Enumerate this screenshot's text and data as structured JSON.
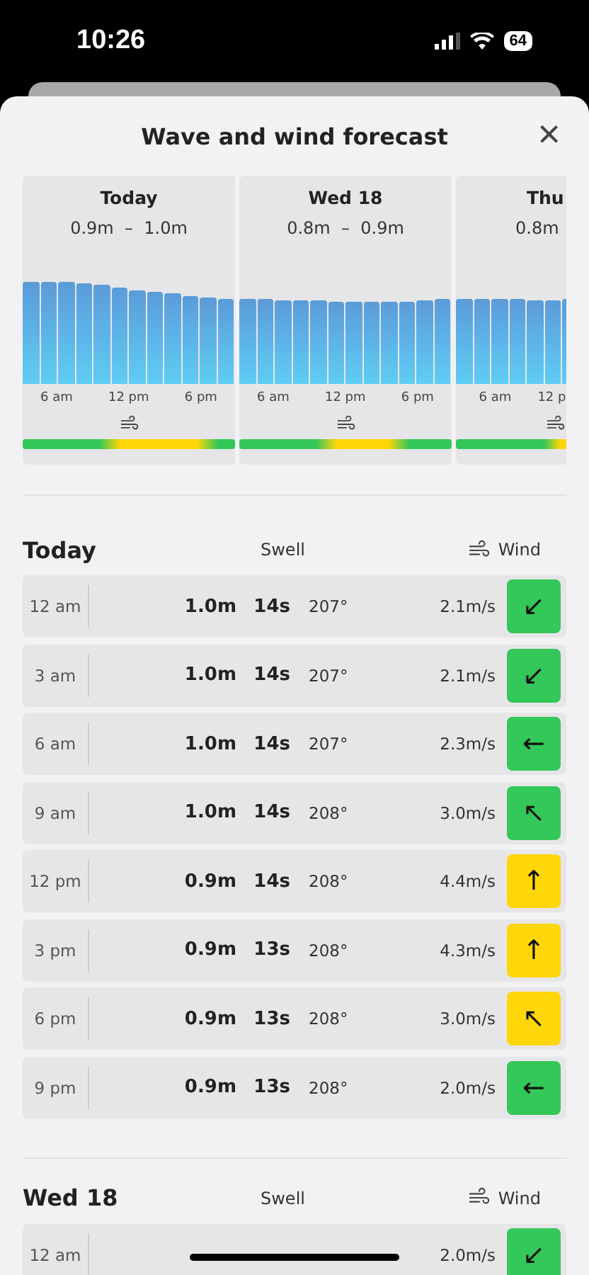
{
  "status_bar": {
    "time": "10:26",
    "battery": "64"
  },
  "sheet": {
    "title": "Wave and wind forecast",
    "close": "×"
  },
  "day_cards": [
    {
      "day": "Today",
      "range": "0.9m  –  1.0m",
      "times": [
        "6 am",
        "12 pm",
        "6 pm"
      ]
    },
    {
      "day": "Wed 18",
      "range": "0.8m  –  0.9m",
      "times": [
        "6 am",
        "12 pm",
        "6 pm"
      ]
    },
    {
      "day": "Thu",
      "range": "0.8m",
      "times": [
        "6 am",
        "12 p"
      ]
    }
  ],
  "days": [
    {
      "title": "Today",
      "swell_label": "Swell",
      "wind_label": "Wind",
      "rows": [
        {
          "time": "12 am",
          "height": "1.0m",
          "period": "14s",
          "direction": "207°",
          "speed": "2.1m/s",
          "arrow": "↙",
          "color": "#34c759"
        },
        {
          "time": "3 am",
          "height": "1.0m",
          "period": "14s",
          "direction": "207°",
          "speed": "2.1m/s",
          "arrow": "↙",
          "color": "#34c759"
        },
        {
          "time": "6 am",
          "height": "1.0m",
          "period": "14s",
          "direction": "207°",
          "speed": "2.3m/s",
          "arrow": "←",
          "color": "#34c759"
        },
        {
          "time": "9 am",
          "height": "1.0m",
          "period": "14s",
          "direction": "208°",
          "speed": "3.0m/s",
          "arrow": "↖",
          "color": "#34c759"
        },
        {
          "time": "12 pm",
          "height": "0.9m",
          "period": "14s",
          "direction": "208°",
          "speed": "4.4m/s",
          "arrow": "↑",
          "color": "#ffd60a"
        },
        {
          "time": "3 pm",
          "height": "0.9m",
          "period": "13s",
          "direction": "208°",
          "speed": "4.3m/s",
          "arrow": "↑",
          "color": "#ffd60a"
        },
        {
          "time": "6 pm",
          "height": "0.9m",
          "period": "13s",
          "direction": "208°",
          "speed": "3.0m/s",
          "arrow": "↖",
          "color": "#ffd60a"
        },
        {
          "time": "9 pm",
          "height": "0.9m",
          "period": "13s",
          "direction": "208°",
          "speed": "2.0m/s",
          "arrow": "←",
          "color": "#34c759"
        }
      ]
    },
    {
      "title": "Wed 18",
      "swell_label": "Swell",
      "wind_label": "Wind",
      "rows": [
        {
          "time": "12 am",
          "speed": "2.0m/s",
          "arrow": "↙",
          "color": "#34c759"
        }
      ]
    }
  ]
}
